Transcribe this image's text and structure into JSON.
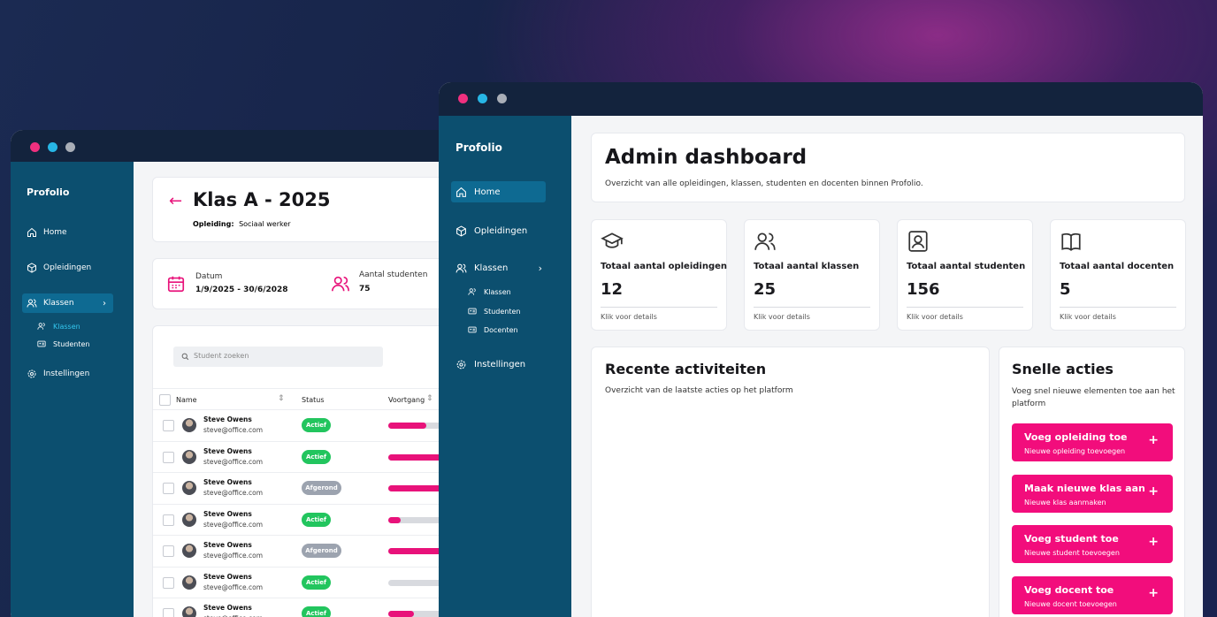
{
  "brand": "Profolio",
  "back": {
    "nav": {
      "home": "Home",
      "opleidingen": "Opleidingen",
      "klassen": "Klassen",
      "sub_klassen": "Klassen",
      "sub_studenten": "Studenten",
      "instellingen": "Instellingen"
    },
    "header": {
      "title": "Klas A - 2025",
      "opleiding_label": "Opleiding:",
      "opleiding_value": "Sociaal werker"
    },
    "info": {
      "datum_label": "Datum",
      "datum_value": "1/9/2025 - 30/6/2028",
      "students_label": "Aantal studenten",
      "students_value": "75"
    },
    "search": {
      "placeholder": "Student zoeken"
    },
    "table": {
      "columns": {
        "name": "Name",
        "status": "Status",
        "progress": "Voortgang"
      },
      "rows": [
        {
          "name": "Steve Owens",
          "email": "steve@office.com",
          "status": "Actief",
          "progress": 0.45
        },
        {
          "name": "Steve Owens",
          "email": "steve@office.com",
          "status": "Actief",
          "progress": 1.0
        },
        {
          "name": "Steve Owens",
          "email": "steve@office.com",
          "status": "Afgerond",
          "progress": 1.0
        },
        {
          "name": "Steve Owens",
          "email": "steve@office.com",
          "status": "Actief",
          "progress": 0.15
        },
        {
          "name": "Steve Owens",
          "email": "steve@office.com",
          "status": "Afgerond",
          "progress": 1.0
        },
        {
          "name": "Steve Owens",
          "email": "steve@office.com",
          "status": "Actief",
          "progress": 0.0
        },
        {
          "name": "Steve Owens",
          "email": "steve@office.com",
          "status": "Actief",
          "progress": 0.3
        }
      ]
    }
  },
  "front": {
    "nav": {
      "home": "Home",
      "opleidingen": "Opleidingen",
      "klassen": "Klassen",
      "sub_klassen": "Klassen",
      "sub_studenten": "Studenten",
      "sub_docenten": "Docenten",
      "instellingen": "Instellingen"
    },
    "header": {
      "title": "Admin dashboard",
      "subtitle": "Overzicht van alle opleidingen, klassen, studenten en docenten binnen Profolio."
    },
    "stats": [
      {
        "title": "Totaal aantal opleidingen",
        "value": "12",
        "link": "Klik voor details",
        "icon": "graduation-cap-icon"
      },
      {
        "title": "Totaal aantal klassen",
        "value": "25",
        "link": "Klik voor details",
        "icon": "users-icon"
      },
      {
        "title": "Totaal aantal studenten",
        "value": "156",
        "link": "Klik voor details",
        "icon": "id-badge-icon"
      },
      {
        "title": "Totaal aantal docenten",
        "value": "5",
        "link": "Klik voor details",
        "icon": "book-icon"
      }
    ],
    "recent": {
      "title": "Recente activiteiten",
      "subtitle": "Overzicht van de laatste acties op het platform"
    },
    "quick": {
      "title": "Snelle acties",
      "subtitle": "Voeg snel nieuwe elementen toe aan het platform",
      "actions": [
        {
          "title": "Voeg opleiding toe",
          "sub": "Nieuwe opleiding toevoegen",
          "plus": "+"
        },
        {
          "title": "Maak nieuwe klas aan",
          "sub": "Nieuwe klas aanmaken",
          "plus": "+"
        },
        {
          "title": "Voeg student toe",
          "sub": "Nieuwe student toevoegen",
          "plus": "+"
        },
        {
          "title": "Voeg docent toe",
          "sub": "Nieuwe docent toevoegen",
          "plus": "+"
        }
      ]
    }
  },
  "colors": {
    "accent": "#e8127a",
    "sidebar": "#0c4f6f",
    "active": "#22c55e",
    "done": "#9ca3af"
  }
}
